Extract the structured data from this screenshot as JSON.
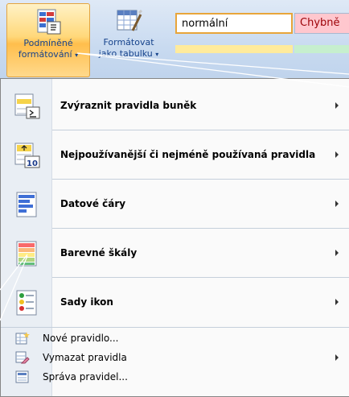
{
  "ribbon": {
    "conditional_formatting": {
      "line1": "Podmíněné",
      "line2": "formátování",
      "dropdown": "▾"
    },
    "format_as_table": {
      "line1": "Formátovat",
      "line2": "jako tabulku",
      "dropdown": "▾"
    },
    "styles": {
      "normal": "normální",
      "bad": "Chybně"
    }
  },
  "menu": {
    "items": [
      {
        "label": "Zvýraznit pravidla buněk",
        "icon": "highlight-cells-rules-icon",
        "submenu": true
      },
      {
        "label": "Nejpoužívanější či nejméně používaná pravidla",
        "icon": "top-bottom-rules-icon",
        "submenu": true
      },
      {
        "label": "Datové čáry",
        "icon": "data-bars-icon",
        "submenu": true
      },
      {
        "label": "Barevné škály",
        "icon": "color-scales-icon",
        "submenu": true
      },
      {
        "label": "Sady ikon",
        "icon": "icon-sets-icon",
        "submenu": true
      }
    ],
    "commands": [
      {
        "label": "Nové pravidlo...",
        "icon": "new-rule-icon",
        "submenu": false
      },
      {
        "label": "Vymazat pravidla",
        "icon": "clear-rules-icon",
        "submenu": true
      },
      {
        "label": "Správa pravidel...",
        "icon": "manage-rules-icon",
        "submenu": false
      }
    ]
  },
  "colors": {
    "background": "#8e1212",
    "highlight": "#ffd87a",
    "callout_line": "#ffffff"
  }
}
